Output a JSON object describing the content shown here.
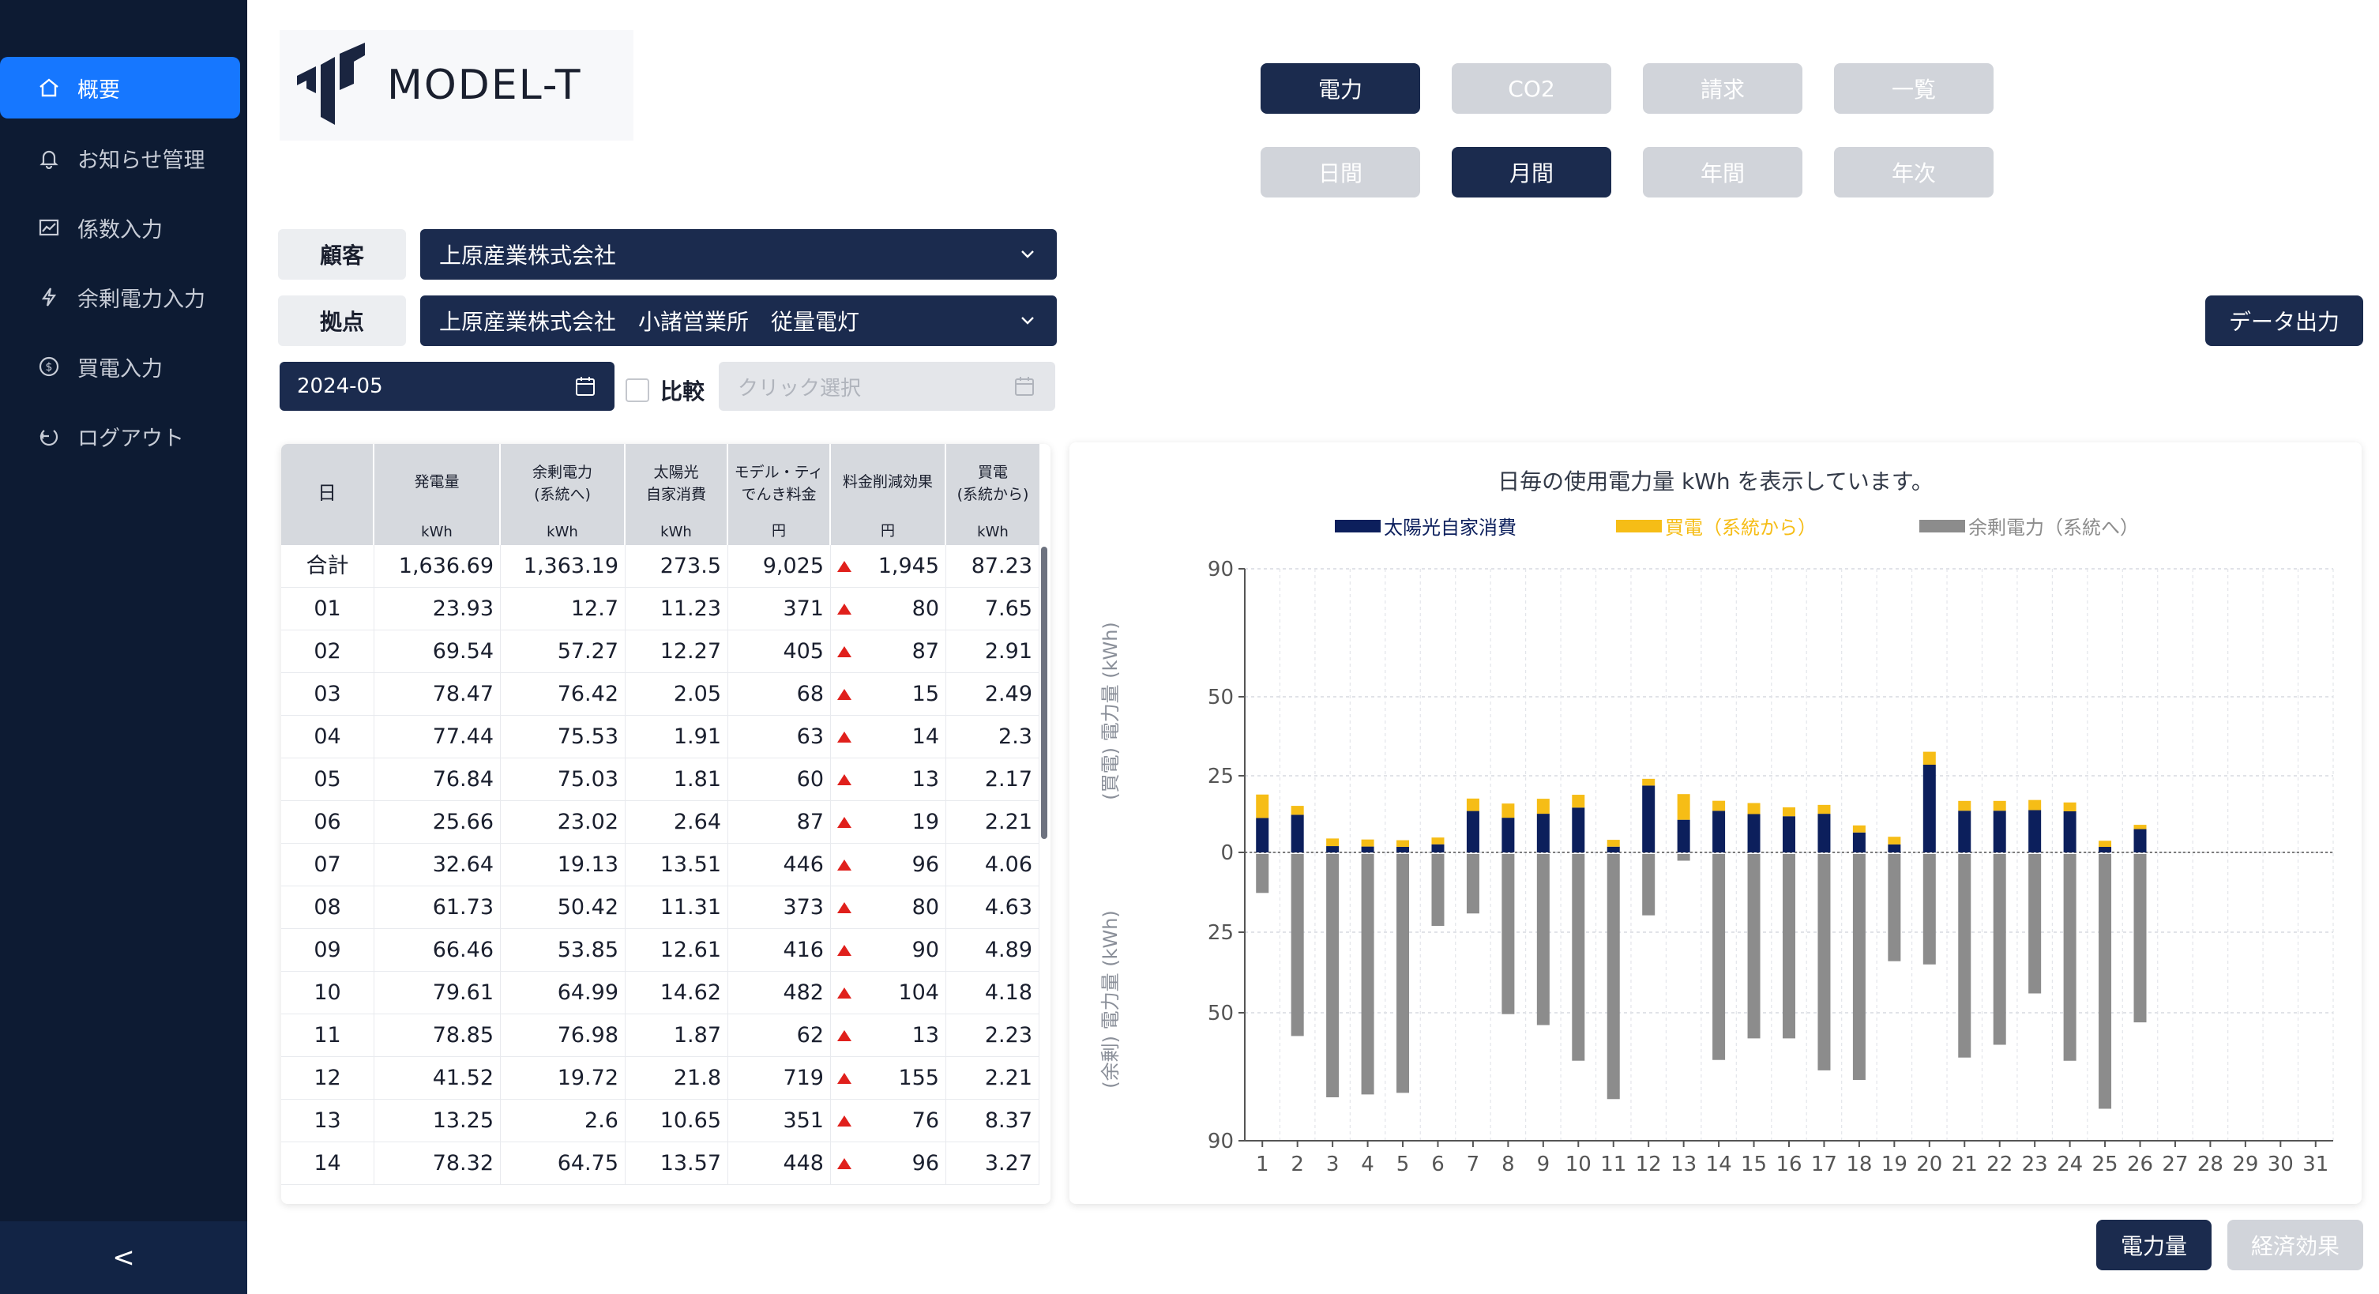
{
  "sidebar": {
    "items": [
      {
        "label": "概要",
        "icon": "home-icon",
        "active": true
      },
      {
        "label": "お知らせ管理",
        "icon": "bell-icon",
        "active": false
      },
      {
        "label": "係数入力",
        "icon": "chart-icon",
        "active": false
      },
      {
        "label": "余剰電力入力",
        "icon": "bolt-icon",
        "active": false
      },
      {
        "label": "買電入力",
        "icon": "dollar-icon",
        "active": false
      },
      {
        "label": "ログアウト",
        "icon": "logout-icon",
        "active": false
      }
    ],
    "collapse_label": "<"
  },
  "logo": {
    "text": "MODEL-T"
  },
  "tabs_top": [
    {
      "label": "電力",
      "active": true
    },
    {
      "label": "CO2",
      "active": false
    },
    {
      "label": "請求",
      "active": false
    },
    {
      "label": "一覧",
      "active": false
    }
  ],
  "tabs_period": [
    {
      "label": "日間",
      "active": false
    },
    {
      "label": "月間",
      "active": true
    },
    {
      "label": "年間",
      "active": false
    },
    {
      "label": "年次",
      "active": false
    }
  ],
  "filters": {
    "customer_label": "顧客",
    "customer_value": "上原産業株式会社",
    "site_label": "拠点",
    "site_value": "上原産業株式会社　小諸営業所　従量電灯",
    "date_value": "2024-05",
    "compare_label": "比較",
    "compare_placeholder": "クリック選択"
  },
  "export_button": "データ出力",
  "bottom_buttons": {
    "power": "電力量",
    "economic": "経済効果"
  },
  "table": {
    "headers": [
      {
        "line1": "日",
        "unit": ""
      },
      {
        "line1": "発電量",
        "unit": "kWh"
      },
      {
        "line1": "余剰電力\n(系統へ)",
        "unit": "kWh"
      },
      {
        "line1": "太陽光\n自家消費",
        "unit": "kWh"
      },
      {
        "line1": "モデル・ティ\nでんき料金",
        "unit": "円"
      },
      {
        "line1": "料金削減効果",
        "unit": "円"
      },
      {
        "line1": "買電\n(系統から)",
        "unit": "kWh"
      }
    ],
    "rows": [
      [
        "合計",
        "1,636.69",
        "1,363.19",
        "273.5",
        "9,025",
        "1,945",
        "87.23"
      ],
      [
        "01",
        "23.93",
        "12.7",
        "11.23",
        "371",
        "80",
        "7.65"
      ],
      [
        "02",
        "69.54",
        "57.27",
        "12.27",
        "405",
        "87",
        "2.91"
      ],
      [
        "03",
        "78.47",
        "76.42",
        "2.05",
        "68",
        "15",
        "2.49"
      ],
      [
        "04",
        "77.44",
        "75.53",
        "1.91",
        "63",
        "14",
        "2.3"
      ],
      [
        "05",
        "76.84",
        "75.03",
        "1.81",
        "60",
        "13",
        "2.17"
      ],
      [
        "06",
        "25.66",
        "23.02",
        "2.64",
        "87",
        "19",
        "2.21"
      ],
      [
        "07",
        "32.64",
        "19.13",
        "13.51",
        "446",
        "96",
        "4.06"
      ],
      [
        "08",
        "61.73",
        "50.42",
        "11.31",
        "373",
        "80",
        "4.63"
      ],
      [
        "09",
        "66.46",
        "53.85",
        "12.61",
        "416",
        "90",
        "4.89"
      ],
      [
        "10",
        "79.61",
        "64.99",
        "14.62",
        "482",
        "104",
        "4.18"
      ],
      [
        "11",
        "78.85",
        "76.98",
        "1.87",
        "62",
        "13",
        "2.23"
      ],
      [
        "12",
        "41.52",
        "19.72",
        "21.8",
        "719",
        "155",
        "2.21"
      ],
      [
        "13",
        "13.25",
        "2.6",
        "10.65",
        "351",
        "76",
        "8.37"
      ],
      [
        "14",
        "78.32",
        "64.75",
        "13.57",
        "448",
        "96",
        "3.27"
      ]
    ]
  },
  "chart_data": {
    "type": "bar",
    "title": "日毎の使用電力量 kWh を表示しています。",
    "legend": [
      "太陽光自家消費",
      "買電（系統から）",
      "余剰電力（系統へ）"
    ],
    "colors": {
      "self": "#0c1f5c",
      "buy": "#f6bd16",
      "surplus": "#8c8c8c"
    },
    "ylabel_top": "(買電) 電力量 (kWh)",
    "ylabel_bottom": "(余剰) 電力量 (kWh)",
    "yticks_top": [
      "90",
      "50",
      "25",
      "0"
    ],
    "yticks_bottom": [
      "25",
      "50",
      "90"
    ],
    "categories": [
      "1",
      "2",
      "3",
      "4",
      "5",
      "6",
      "7",
      "8",
      "9",
      "10",
      "11",
      "12",
      "13",
      "14",
      "15",
      "16",
      "17",
      "18",
      "19",
      "20",
      "21",
      "22",
      "23",
      "24",
      "25",
      "26",
      "27",
      "28",
      "29",
      "30",
      "31"
    ],
    "self_consumption": [
      11.23,
      12.27,
      2.05,
      1.91,
      1.81,
      2.64,
      13.51,
      11.31,
      12.61,
      14.62,
      1.87,
      21.8,
      10.65,
      13.57,
      12.5,
      11.8,
      12.6,
      6.5,
      2.6,
      28.5,
      13.6,
      13.6,
      13.8,
      13.4,
      1.8,
      7.6,
      0,
      0,
      0,
      0,
      0
    ],
    "buy_power": [
      7.65,
      2.91,
      2.49,
      2.3,
      2.17,
      2.21,
      4.06,
      4.63,
      4.89,
      4.18,
      2.23,
      2.21,
      8.37,
      3.27,
      3.6,
      2.9,
      2.9,
      2.3,
      2.5,
      4.1,
      3.2,
      3.2,
      3.3,
      2.9,
      2.0,
      1.4,
      0,
      0,
      0,
      0,
      0
    ],
    "surplus": [
      12.7,
      57.27,
      76.42,
      75.53,
      75.03,
      23.02,
      19.13,
      50.42,
      53.85,
      64.99,
      76.98,
      19.72,
      2.6,
      64.75,
      58.0,
      58.0,
      68.0,
      71.0,
      34.0,
      35.0,
      64.0,
      60.0,
      44.0,
      65.0,
      80.0,
      53.0,
      0,
      0,
      0,
      0,
      0
    ]
  }
}
